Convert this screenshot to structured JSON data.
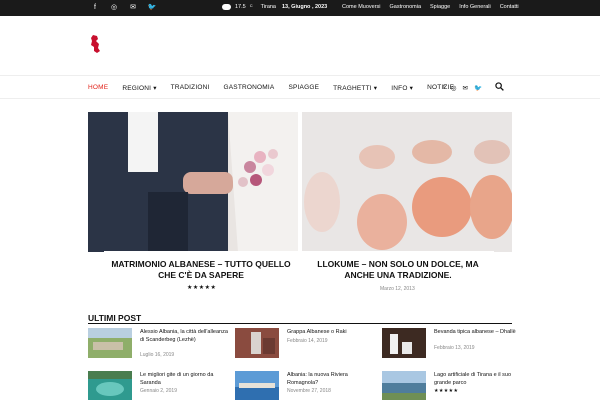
{
  "topbar": {
    "social_icons": [
      "facebook-icon",
      "instagram-icon",
      "mail-icon",
      "twitter-icon"
    ],
    "weather": {
      "temp": "17.5",
      "unit": "C",
      "city": "Tirana"
    },
    "date": "13, Giugno , 2023",
    "links": [
      "Come Muoversi",
      "Gastronomia",
      "Spiagge",
      "Info Generali",
      "Contatti"
    ]
  },
  "nav": {
    "items": [
      {
        "label": "HOME",
        "active": true
      },
      {
        "label": "REGIONI",
        "arrow": "▾"
      },
      {
        "label": "TRADIZIONI"
      },
      {
        "label": "GASTRONOMIA"
      },
      {
        "label": "SPIAGGE"
      },
      {
        "label": "TRAGHETTI",
        "arrow": "▾"
      },
      {
        "label": "INFO",
        "arrow": "▾"
      },
      {
        "label": "NOTIZIE"
      }
    ],
    "social_icons": [
      "facebook-icon",
      "instagram-icon",
      "mail-icon",
      "twitter-icon"
    ],
    "search_icon": "search-icon"
  },
  "featured": [
    {
      "title": "MATRIMONIO ALBANESE – TUTTO QUELLO CHE C'È DA SAPERE",
      "rating": "★★★★★"
    },
    {
      "title": "LLOKUME – NON SOLO UN DOLCE, MA ANCHE UNA TRADIZIONE.",
      "date": "Marzo 12, 2013"
    }
  ],
  "section": {
    "title": "ULTIMI POST"
  },
  "posts": [
    {
      "title": "Alessio Albania, la città dell'alleanza di Scanderbeg (Lezhë)",
      "date": "Luglio 16, 2019"
    },
    {
      "title": "Grappa Albanese o Raki",
      "date": "Febbraio 14, 2019"
    },
    {
      "title": "Bevanda tipica albanese – Dhallë",
      "date": "Febbraio 13, 2019"
    },
    {
      "title": "Le migliori gite di un giorno da Saranda",
      "date": "Gennaio 2, 2019"
    },
    {
      "title": "Albania: la nuova Riviera Romagnola?",
      "date": "Novembre 27, 2018"
    },
    {
      "title": "Lago artificiale di Tirana e il suo grande parco",
      "rating": "★★★★★"
    }
  ],
  "colors": {
    "accent": "#e2231a",
    "topbar": "#1a1a1a"
  }
}
